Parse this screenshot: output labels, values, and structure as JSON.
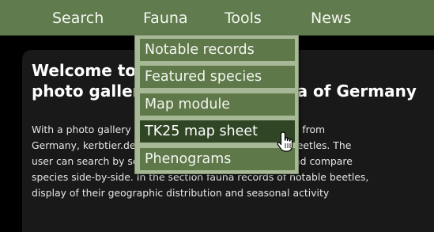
{
  "nav": {
    "items": [
      {
        "label": "Search"
      },
      {
        "label": "Fauna"
      },
      {
        "label": "Tools"
      },
      {
        "label": "News"
      }
    ]
  },
  "dropdown": {
    "items": [
      {
        "label": "Notable records"
      },
      {
        "label": "Featured species"
      },
      {
        "label": "Map module"
      },
      {
        "label": "TK25 map sheet",
        "hovered": true
      },
      {
        "label": "Phenograms"
      }
    ]
  },
  "welcome": {
    "title_line1": "Welcome to Käfer-Atlas –",
    "title_line2": "photo gallery and beetle fauna of Germany",
    "paragraph_lines": [
      "With a photo gallery of more than 7000 beetle species from",
      "Germany, kerbtier.de assists in the determination of beetles. The",
      "user can search by scientific name and appearance and compare",
      "species side-by-side. In the section fauna records of notable beetles,",
      "display of their geographic distribution and seasonal activity"
    ]
  },
  "colors": {
    "nav_background": "#607b4e",
    "menu_item": "#5e7849",
    "menu_item_hover": "#2f4524",
    "dropdown_background": "#a7b896",
    "content_background": "#191919"
  },
  "icons": {
    "cursor": "hand-pointer-icon"
  }
}
